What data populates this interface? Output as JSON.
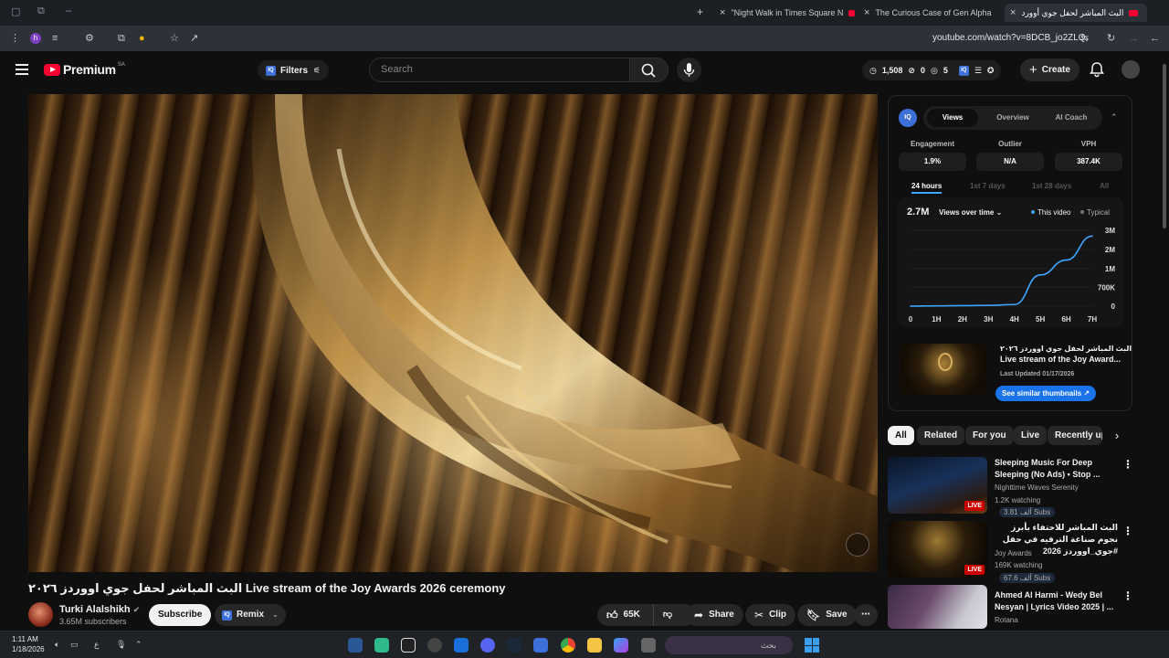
{
  "browser": {
    "tabs": [
      {
        "label": "\"Night Walk in Times Square N"
      },
      {
        "label": "The Curious Case of Gen Alpha"
      },
      {
        "label": "البث المباشر لحفل جوي أوورد"
      }
    ],
    "url": "youtube.com/watch?v=8DCB_jo2ZLQ",
    "profile_initial": "h"
  },
  "masthead": {
    "logo_text": "Premium",
    "country": "SA",
    "filters_label": "Filters",
    "search_placeholder": "Search",
    "stats": {
      "count1": "1,508",
      "count2": "0",
      "count3": "5"
    },
    "create_label": "Create"
  },
  "video": {
    "title": "البث المباشر لحفل جوي اووردز ٢٠٢٦ Live stream of the Joy Awards 2026 ceremony",
    "channel": "Turki Alalshikh",
    "subscribers": "3.65M subscribers",
    "subscribe_label": "Subscribe",
    "remix_label": "Remix",
    "likes": "65K",
    "share_label": "Share",
    "clip_label": "Clip",
    "save_label": "Save"
  },
  "iq": {
    "badge": "IQ",
    "tabs": [
      "Views",
      "Overview",
      "AI Coach"
    ],
    "active_tab": "Views",
    "metrics": [
      {
        "label": "Engagement",
        "value": "1.9%"
      },
      {
        "label": "Outlier",
        "value": "N/A"
      },
      {
        "label": "VPH",
        "value": "387.4K"
      }
    ],
    "ranges": [
      "24 hours",
      "1st 7 days",
      "1st 28 days",
      "All"
    ],
    "active_range": "24 hours",
    "total_views": "2.7M",
    "graph_mode": "Views over time",
    "legend_this": "This video",
    "legend_typical": "Typical",
    "thumb_title_ar": "البث المباشر لحفل جوي اووردز ٢٠٢٦",
    "thumb_title_en": "Live stream of the Joy Award...",
    "last_updated": "Last Updated 01/17/2026",
    "similar_label": "See similar thumbnails"
  },
  "chart_data": {
    "type": "line",
    "title": "",
    "x": [
      "0",
      "1H",
      "2H",
      "3H",
      "4H",
      "5H",
      "6H",
      "7H"
    ],
    "ytick_labels": [
      "0",
      "700K",
      "1M",
      "2M",
      "3M"
    ],
    "ylim": [
      0,
      3000000
    ],
    "series": [
      {
        "name": "This video",
        "values": [
          0,
          10000,
          20000,
          30000,
          60000,
          900000,
          1450000,
          2700000
        ]
      }
    ],
    "colors": {
      "line": "#3ea6ff",
      "grid": "#2a2a2a"
    }
  },
  "chips": [
    "All",
    "Related",
    "For you",
    "Live",
    "Recently up"
  ],
  "active_chip": "All",
  "recommendations": [
    {
      "title": "Sleeping Music For Deep Sleeping (No Ads) • Stop ...",
      "channel": "Nighttime Waves Serenity",
      "watching": "1.2K watching",
      "subs": "3.81 ألف Subs",
      "live": "LIVE",
      "rtl": false
    },
    {
      "title": "البث المباشر للاحتفاء بأبرز نجوم صناعة الترفيه في حفل #جوي_اووردز 2026",
      "channel": "Joy Awards",
      "watching": "169K watching",
      "subs": "67.6 ألف Subs",
      "live": "LIVE",
      "rtl": true
    },
    {
      "title": "Ahmed Al Harmi - Wedy Bel Nesyan | Lyrics Video 2025 | ...",
      "channel": "Rotana",
      "watching": "",
      "subs": "",
      "live": "",
      "rtl": false
    }
  ],
  "taskbar": {
    "time": "1:11 AM",
    "date": "1/18/2026",
    "lang": "ع",
    "search_placeholder": "بحث"
  }
}
